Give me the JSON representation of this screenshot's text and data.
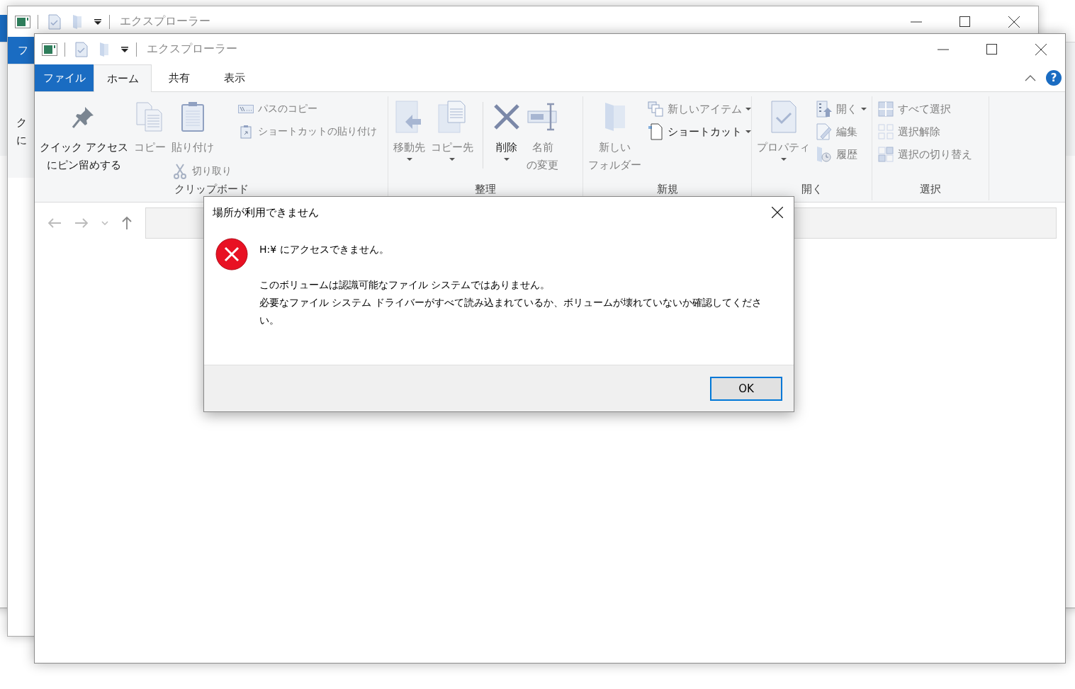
{
  "background_windows": [
    {
      "kind": "edge"
    },
    {
      "kind": "window",
      "title": "エクスプローラー",
      "file_tab": "フ",
      "ribbon_texts": [
        "ク",
        "に"
      ]
    }
  ],
  "window": {
    "title": "エクスプローラー",
    "tabs": [
      {
        "label": "ファイル",
        "kind": "file",
        "selected": false
      },
      {
        "label": "ホーム",
        "kind": "tab",
        "selected": true
      },
      {
        "label": "共有",
        "kind": "tab",
        "selected": false
      },
      {
        "label": "表示",
        "kind": "tab",
        "selected": false
      }
    ],
    "help_label": "?",
    "ribbon": {
      "groups": [
        {
          "label": "クリップボード",
          "columns": [
            {
              "items": [
                {
                  "kind": "large",
                  "label_lines": [
                    "クイック アクセス",
                    "にピン留めする"
                  ],
                  "disabled": false,
                  "dropdown": false
                }
              ]
            },
            {
              "items": [
                {
                  "kind": "large",
                  "label": "コピー",
                  "disabled": true,
                  "dropdown": false
                }
              ]
            },
            {
              "items": [
                {
                  "kind": "large",
                  "label": "貼り付け",
                  "disabled": true,
                  "dropdown": false
                },
                {
                  "kind": "small",
                  "label": "切り取り",
                  "disabled": true,
                  "dropdown": false
                }
              ]
            },
            {
              "items": [
                {
                  "kind": "small",
                  "label": "パスのコピー",
                  "disabled": true,
                  "dropdown": false
                },
                {
                  "kind": "small",
                  "label": "ショートカットの貼り付け",
                  "disabled": true,
                  "dropdown": false
                }
              ]
            }
          ]
        },
        {
          "label": "整理",
          "columns": [
            {
              "items": [
                {
                  "kind": "large",
                  "label": "移動先",
                  "disabled": true,
                  "dropdown": true
                }
              ]
            },
            {
              "items": [
                {
                  "kind": "large",
                  "label": "コピー先",
                  "disabled": true,
                  "dropdown": true
                }
              ]
            },
            {
              "kind": "separator"
            },
            {
              "items": [
                {
                  "kind": "large",
                  "label": "削除",
                  "disabled": false,
                  "dropdown": true
                }
              ]
            },
            {
              "items": [
                {
                  "kind": "large",
                  "label_lines": [
                    "名前",
                    "の変更"
                  ],
                  "disabled": true,
                  "dropdown": false
                }
              ]
            }
          ]
        },
        {
          "label": "新規",
          "columns": [
            {
              "items": [
                {
                  "kind": "large",
                  "label_lines": [
                    "新しい",
                    "フォルダー"
                  ],
                  "disabled": true,
                  "dropdown": false
                }
              ]
            },
            {
              "items": [
                {
                  "kind": "small",
                  "label": "新しいアイテム",
                  "disabled": true,
                  "dropdown": true
                },
                {
                  "kind": "small",
                  "label": "ショートカット",
                  "disabled": false,
                  "dropdown": true
                }
              ]
            }
          ]
        },
        {
          "label": "開く",
          "columns": [
            {
              "items": [
                {
                  "kind": "large",
                  "label": "プロパティ",
                  "disabled": true,
                  "dropdown": true
                }
              ]
            },
            {
              "items": [
                {
                  "kind": "small",
                  "label": "開く",
                  "disabled": true,
                  "dropdown": true
                },
                {
                  "kind": "small",
                  "label": "編集",
                  "disabled": true,
                  "dropdown": false
                },
                {
                  "kind": "small",
                  "label": "履歴",
                  "disabled": true,
                  "dropdown": false
                }
              ]
            }
          ]
        },
        {
          "label": "選択",
          "columns": [
            {
              "items": [
                {
                  "kind": "small",
                  "label": "すべて選択",
                  "disabled": true,
                  "dropdown": false
                },
                {
                  "kind": "small",
                  "label": "選択解除",
                  "disabled": true,
                  "dropdown": false
                },
                {
                  "kind": "small",
                  "label": "選択の切り替え",
                  "disabled": true,
                  "dropdown": false
                }
              ]
            }
          ]
        }
      ]
    }
  },
  "dialog": {
    "title": "場所が利用できません",
    "message": "H:¥ にアクセスできません。",
    "details": [
      "このボリュームは認識可能なファイル システムではありません。",
      "必要なファイル システム ドライバーがすべて読み込まれているか、ボリュームが壊れていないか確認してください。"
    ],
    "button": "OK"
  }
}
